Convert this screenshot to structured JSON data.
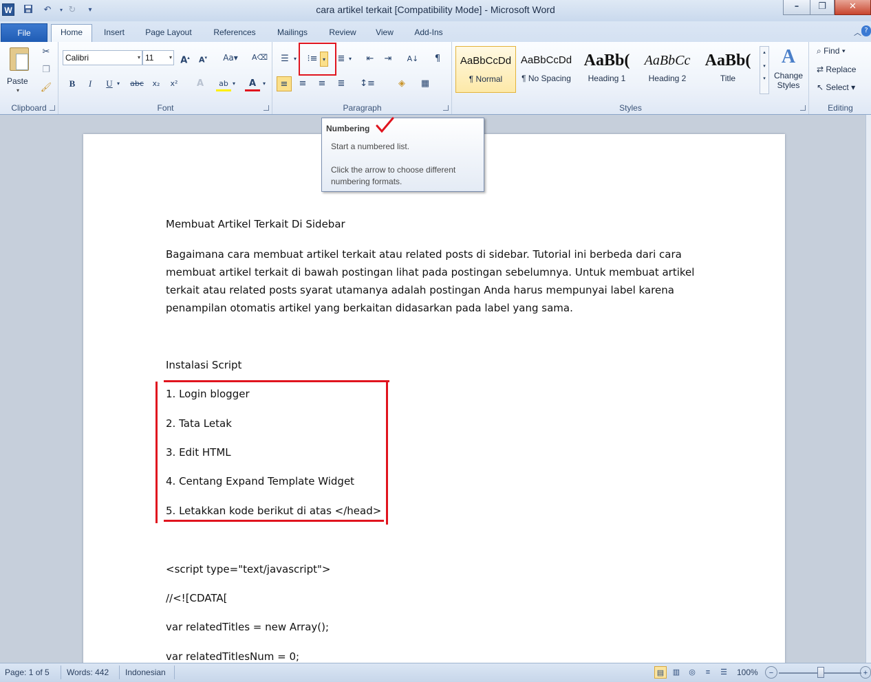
{
  "window": {
    "title": "cara artikel terkait [Compatibility Mode]  -  Microsoft Word",
    "app_icon": "W",
    "minimize": "–",
    "maximize": "❐",
    "close": "✕"
  },
  "qat": {
    "save_icon": "💾",
    "undo_icon": "↶",
    "redo_icon": "↻",
    "customize_icon": "▾"
  },
  "tabs": [
    "File",
    "Home",
    "Insert",
    "Page Layout",
    "References",
    "Mailings",
    "Review",
    "View",
    "Add-Ins"
  ],
  "active_tab": "Home",
  "ribbon": {
    "clipboard": {
      "label": "Clipboard",
      "paste": "Paste"
    },
    "font": {
      "label": "Font",
      "family": "Calibri",
      "size": "11"
    },
    "paragraph": {
      "label": "Paragraph"
    },
    "styles": {
      "label": "Styles",
      "items": [
        {
          "sample": "AaBbCcDd",
          "name": "¶ Normal"
        },
        {
          "sample": "AaBbCcDd",
          "name": "¶ No Spacing"
        },
        {
          "sample": "AaBb(",
          "name": "Heading 1"
        },
        {
          "sample": "AaBbCc",
          "name": "Heading 2"
        },
        {
          "sample": "AaBb(",
          "name": "Title"
        }
      ],
      "change_styles_1": "Change",
      "change_styles_2": "Styles"
    },
    "editing": {
      "label": "Editing",
      "find": "Find",
      "replace": "Replace",
      "select": "Select"
    }
  },
  "tooltip": {
    "title": "Numbering",
    "line1": "Start a numbered list.",
    "line2": "Click the arrow to choose different",
    "line3": "numbering formats."
  },
  "document": {
    "heading": "Membuat Artikel Terkait Di Sidebar",
    "paragraph_lines": [
      "Bagaimana cara membuat artikel terkait atau related posts di sidebar. Tutorial ini berbeda dari cara",
      "membuat artikel terkait di bawah postingan lihat pada postingan sebelumnya. Untuk membuat artikel",
      "terkait atau related posts syarat utamanya adalah postingan Anda harus mempunyai label karena",
      "penampilan otomatis artikel yang berkaitan didasarkan pada label yang sama."
    ],
    "subheading": "Instalasi Script",
    "list": [
      "1. Login blogger",
      "2. Tata Letak",
      "3. Edit HTML",
      "4. Centang Expand Template Widget",
      "5. Letakkan kode berikut di atas </head>"
    ],
    "code": [
      "<script type=\"text/javascript\">",
      "//<![CDATA[",
      "var relatedTitles = new Array();",
      "var relatedTitlesNum = 0;"
    ]
  },
  "status": {
    "page": "Page: 1 of 5",
    "words": "Words: 442",
    "language": "Indonesian",
    "zoom": "100%"
  },
  "colors": {
    "highlight_red": "#e0141e",
    "ribbon_file_tab": "#1e5bb4"
  }
}
